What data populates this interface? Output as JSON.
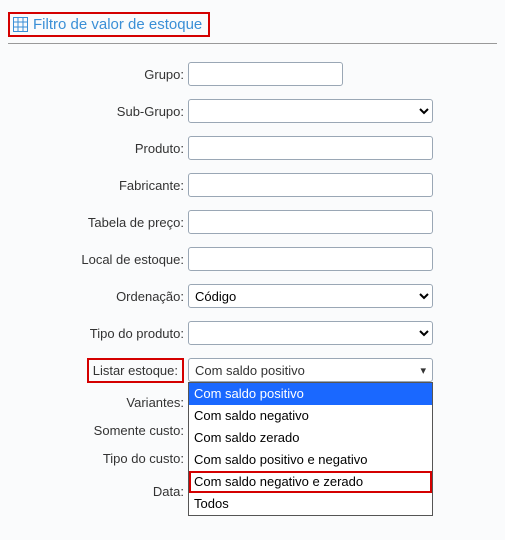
{
  "header": {
    "title": "Filtro de valor de estoque"
  },
  "form": {
    "grupo": {
      "label": "Grupo:",
      "value": ""
    },
    "subgrupo": {
      "label": "Sub-Grupo:",
      "selected": ""
    },
    "produto": {
      "label": "Produto:",
      "value": ""
    },
    "fabricante": {
      "label": "Fabricante:",
      "value": ""
    },
    "tabela_preco": {
      "label": "Tabela de preço:",
      "value": ""
    },
    "local_estoque": {
      "label": "Local de estoque:",
      "value": ""
    },
    "ordenacao": {
      "label": "Ordenação:",
      "selected": "Código"
    },
    "tipo_produto": {
      "label": "Tipo do produto:",
      "selected": ""
    },
    "listar_estoque": {
      "label": "Listar estoque:",
      "selected": "Com saldo positivo",
      "options": [
        "Com saldo positivo",
        "Com saldo negativo",
        "Com saldo zerado",
        "Com saldo positivo e negativo",
        "Com saldo negativo e zerado",
        "Todos"
      ]
    },
    "variantes": {
      "label": "Variantes:"
    },
    "somente_custo": {
      "label": "Somente custo:"
    },
    "tipo_custo": {
      "label": "Tipo do custo:"
    },
    "data": {
      "label": "Data:",
      "value": ""
    }
  }
}
